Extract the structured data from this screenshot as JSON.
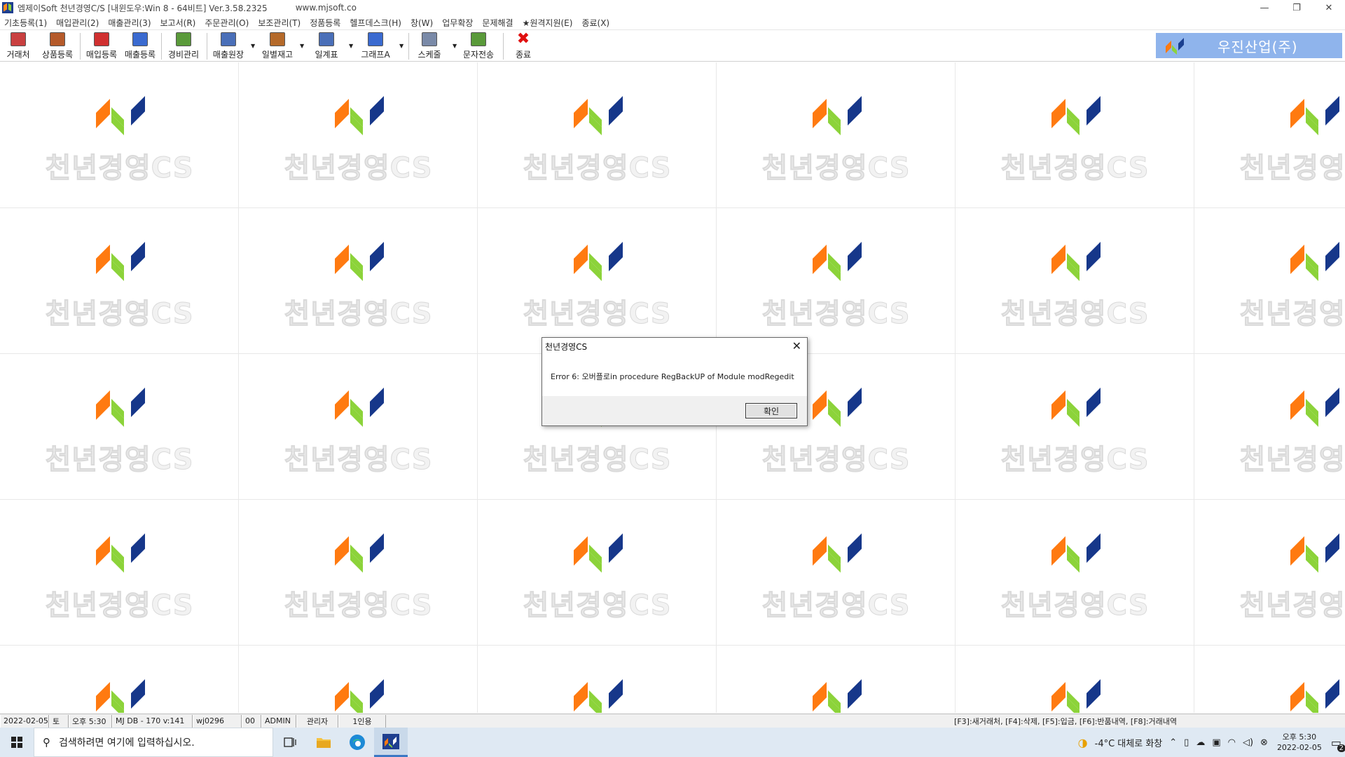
{
  "window": {
    "title": "엠제이Soft 천년경영C/S [내윈도우:Win 8 - 64비트] Ver.3.58.2325",
    "url": "www.mjsoft.co",
    "controls": [
      "—",
      "❐",
      "✕"
    ]
  },
  "menu": [
    {
      "label": "기초등록(1)"
    },
    {
      "label": "매입관리(2)"
    },
    {
      "label": "매출관리(3)"
    },
    {
      "label": "보고서(R)"
    },
    {
      "label": "주문관리(O)"
    },
    {
      "label": "보조관리(T)"
    },
    {
      "label": "정품등록"
    },
    {
      "label": "헬프데스크(H)"
    },
    {
      "label": "창(W)"
    },
    {
      "label": "업무확장"
    },
    {
      "label": "문제해결"
    },
    {
      "label": "★원격지원(E)"
    },
    {
      "label": "종료(X)"
    }
  ],
  "toolbar": {
    "buttons": [
      {
        "label": "거래처",
        "icon": "client-icon",
        "color": "#c94040"
      },
      {
        "label": "상품등록",
        "icon": "product-icon",
        "color": "#b55a2a"
      },
      {
        "label": "매입등록",
        "icon": "purchase-icon",
        "color": "#d03030"
      },
      {
        "label": "매출등록",
        "icon": "sales-icon",
        "color": "#3a6ad0"
      },
      {
        "label": "경비관리",
        "icon": "expense-icon",
        "color": "#5a9a3a"
      },
      {
        "label": "매출원장",
        "icon": "ledger-icon",
        "color": "#4a6fb8"
      },
      {
        "label": "일별재고",
        "icon": "inventory-icon",
        "color": "#b56a2a"
      },
      {
        "label": "일계표",
        "icon": "daily-report-icon",
        "color": "#4a6fb8"
      },
      {
        "label": "그래프A",
        "icon": "graph-icon",
        "color": "#3a6ad0"
      },
      {
        "label": "스케줄",
        "icon": "schedule-icon",
        "color": "#7a8aa8"
      },
      {
        "label": "문자전송",
        "icon": "sms-icon",
        "color": "#5a9a3a"
      },
      {
        "label": "종료",
        "icon": "exit-icon",
        "color": "#e01010"
      }
    ],
    "company": "우진산업(주)"
  },
  "wallpaper": {
    "tile_text": "천년경영CS"
  },
  "dialog": {
    "title": "천년경영CS",
    "message": "Error 6: 오버플로in procedure RegBackUP of Module modRegedit",
    "ok": "확인",
    "close": "✕"
  },
  "status": {
    "date": "2022-02-05",
    "weekday": "토",
    "time": "오후 5:30",
    "db": "MJ DB - 170 v:141",
    "user_id": "wj0296",
    "code": "00",
    "user": "ADMIN",
    "role": "관리자",
    "license": "1인용",
    "hint": "[F3]:새거래처, [F4]:삭제, [F5]:입금, [F6]:반품내역, [F8]:거래내역"
  },
  "taskbar": {
    "search_placeholder": "검색하려면 여기에 입력하십시오.",
    "weather": "-4°C 대체로 화창",
    "clock_time": "오후 5:30",
    "clock_date": "2022-02-05",
    "notif_count": "2"
  }
}
